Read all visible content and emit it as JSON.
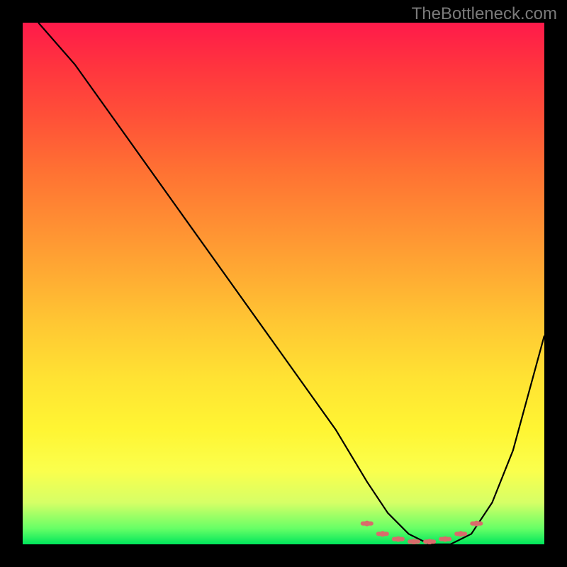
{
  "watermark": "TheBottleneck.com",
  "chart_data": {
    "type": "line",
    "title": "",
    "xlabel": "",
    "ylabel": "",
    "xlim": [
      0,
      100
    ],
    "ylim": [
      0,
      100
    ],
    "grid": false,
    "series": [
      {
        "name": "curve",
        "x": [
          3,
          10,
          20,
          30,
          40,
          50,
          60,
          66,
          70,
          74,
          78,
          82,
          86,
          90,
          94,
          100
        ],
        "y": [
          100,
          92,
          78,
          64,
          50,
          36,
          22,
          12,
          6,
          2,
          0,
          0,
          2,
          8,
          18,
          40
        ]
      }
    ],
    "markers": {
      "style": "dashed-dots",
      "color": "#d96b6b",
      "x": [
        66,
        69,
        72,
        75,
        78,
        81,
        84,
        87
      ],
      "y": [
        4,
        2,
        1,
        0.5,
        0.5,
        1,
        2,
        4
      ]
    },
    "background_gradient": {
      "top": "#ff1a4a",
      "mid": "#ffe233",
      "bottom": "#00e65c"
    }
  }
}
